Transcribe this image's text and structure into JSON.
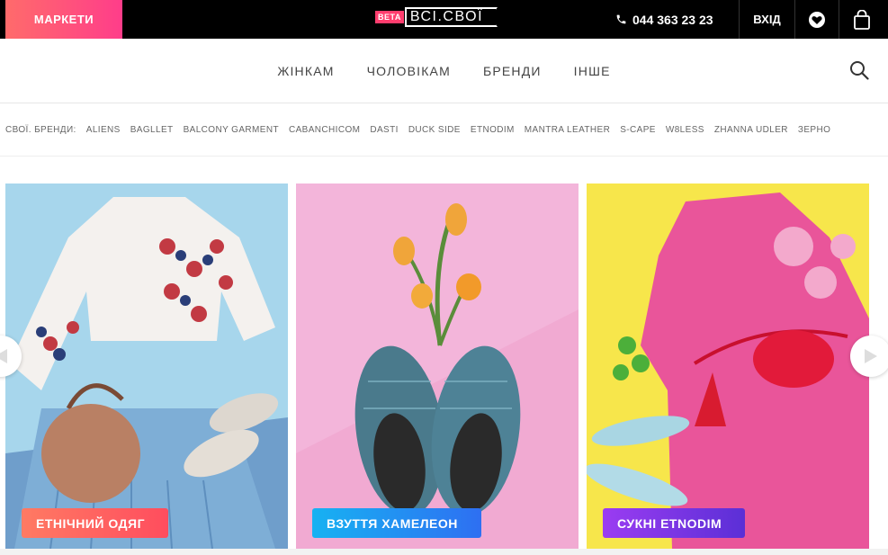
{
  "topbar": {
    "markets_label": "МАРКЕТИ",
    "logo_beta": "BETA",
    "logo_text": "ВСІ.СВОЇ",
    "phone": "044 363 23 23",
    "login": "ВХІД"
  },
  "nav": {
    "items": [
      "ЖІНКАМ",
      "ЧОЛОВІКАМ",
      "БРЕНДИ",
      "ІНШЕ"
    ]
  },
  "brands": {
    "label": "СВОЇ. БРЕНДИ:",
    "items": [
      "ALIENS",
      "BAGLLET",
      "BALCONY GARMENT",
      "CABANCHICOM",
      "DASTI",
      "DUCK SIDE",
      "ETNODIM",
      "MANTRA LEATHER",
      "S-CAPE",
      "W8LESS",
      "ZHANNA UDLER",
      "ЗЕРНО"
    ]
  },
  "banners": [
    {
      "label": "ЕТНІЧНИЙ ОДЯГ",
      "colors": [
        "#ff7a63",
        "#ff4d5e"
      ],
      "bg": "#9fd3ea"
    },
    {
      "label": "ВЗУТТЯ ХАМЕЛЕОН",
      "colors": [
        "#17b2f2",
        "#2e6ff2"
      ],
      "bg": "#f0a6cf"
    },
    {
      "label": "СУКНІ ETNODIM",
      "colors": [
        "#9b3cf2",
        "#5b2fd6"
      ],
      "bg": "#f6e84a"
    }
  ],
  "colors": {
    "accent": "#ff3d8a",
    "topbar": "#000000"
  }
}
